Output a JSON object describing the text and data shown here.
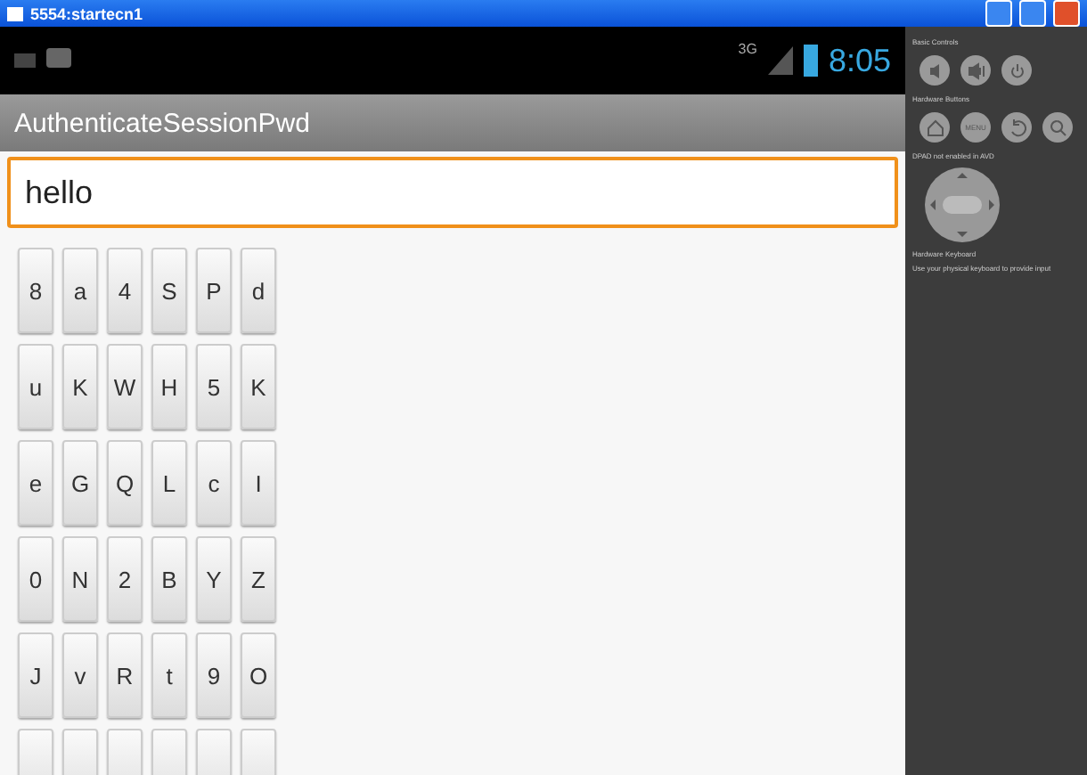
{
  "window": {
    "title": "5554:startecn1"
  },
  "status_bar": {
    "network": "3G",
    "time": "8:05"
  },
  "action_bar": {
    "title": "AuthenticateSessionPwd"
  },
  "password_field": {
    "value": "hello"
  },
  "keypad": [
    [
      "8",
      "a",
      "4",
      "S",
      "P",
      "d"
    ],
    [
      "u",
      "K",
      "W",
      "H",
      "5",
      "K"
    ],
    [
      "e",
      "G",
      "Q",
      "L",
      "c",
      "I"
    ],
    [
      "0",
      "N",
      "2",
      "B",
      "Y",
      "Z"
    ],
    [
      "J",
      "v",
      "R",
      "t",
      "9",
      "O"
    ]
  ],
  "controls": {
    "basic_label": "Basic Controls",
    "hardware_label": "Hardware Buttons",
    "menu_key": "MENU",
    "dpad_label": "DPAD not enabled in AVD",
    "keyboard_label": "Hardware Keyboard",
    "keyboard_hint": "Use your physical keyboard to provide input"
  }
}
